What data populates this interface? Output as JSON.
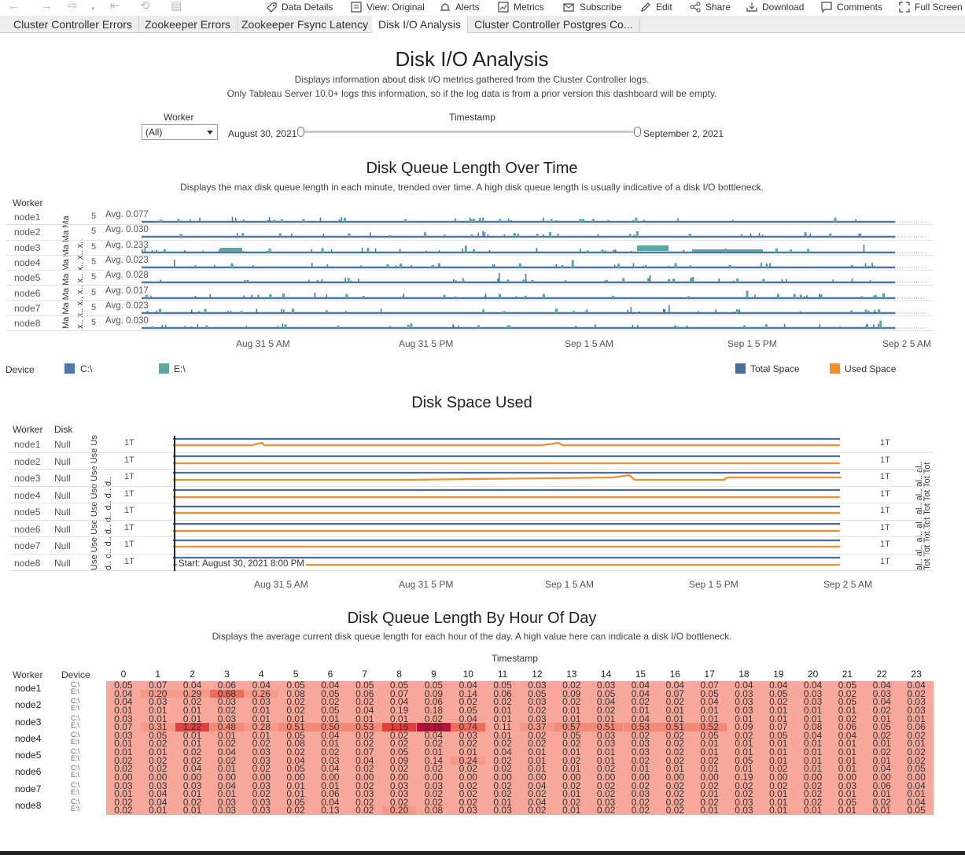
{
  "toolbar": {
    "items": [
      {
        "label": "Data Details",
        "icon": "bubble-icon"
      },
      {
        "label": "View: Original",
        "icon": "view-icon"
      },
      {
        "label": "Alerts",
        "icon": "bell-icon"
      },
      {
        "label": "Metrics",
        "icon": "metrics-icon"
      },
      {
        "label": "Subscribe",
        "icon": "mail-icon"
      },
      {
        "label": "Edit",
        "icon": "pencil-icon"
      },
      {
        "label": "Share",
        "icon": "share-icon"
      },
      {
        "label": "Download",
        "icon": "download-icon"
      },
      {
        "label": "Comments",
        "icon": "comment-icon"
      },
      {
        "label": "Full Screen",
        "icon": "fullscreen-icon"
      }
    ]
  },
  "tabs": [
    {
      "label": "Cluster Controller Errors",
      "active": false
    },
    {
      "label": "Zookeeper Errors",
      "active": false
    },
    {
      "label": "Zookeeper Fsync Latency",
      "active": false
    },
    {
      "label": "Disk I/O Analysis",
      "active": true
    },
    {
      "label": "Cluster Controller Postgres Co...",
      "active": false
    }
  ],
  "dashboard": {
    "title": "Disk I/O Analysis",
    "desc1": "Displays information about disk I/O metrics gathered from the Cluster Controller logs.",
    "desc2": "Only Tableau Server 10.0+ logs this information, so if the log data is from a prior version this dashboard will be empty."
  },
  "filters": {
    "worker_label": "Worker",
    "worker_value": "(All)",
    "timestamp_label": "Timestamp",
    "start": "August 30, 2021",
    "end": "September 2, 2021"
  },
  "queue_chart": {
    "title": "Disk Queue Length Over Time",
    "subtitle": "Displays the max disk queue length in each minute, trended over time.  A high disk queue length is usually indicative of a disk I/O bottleneck.",
    "header": "Worker",
    "rows": [
      {
        "node": "node1",
        "avg": "Avg. 0.077"
      },
      {
        "node": "node2",
        "avg": "Avg. 0.030"
      },
      {
        "node": "node3",
        "avg": "Avg. 0.233"
      },
      {
        "node": "node4",
        "avg": "Avg. 0.023"
      },
      {
        "node": "node5",
        "avg": "Avg. 0.028"
      },
      {
        "node": "node6",
        "avg": "Avg. 0.017"
      },
      {
        "node": "node7",
        "avg": "Avg. 0.023"
      },
      {
        "node": "node8",
        "avg": "Avg. 0.030"
      }
    ],
    "yticks": [
      "5",
      "5",
      "5",
      "5",
      "5",
      "5",
      "5",
      "5"
    ],
    "vertical_axis_a": "Ma Ma Ma Ma Ma Ma Ma Ma",
    "vertical_axis_b": "x.. x.. x.. x.. x.. x.. x.. x..",
    "xticks": [
      "Aug 31 5 AM",
      "Aug 31 5 PM",
      "Sep 1 5 AM",
      "Sep 1 5 PM",
      "Sep 2 5 AM"
    ]
  },
  "legends": {
    "device_label": "Device",
    "device_c": "C:\\",
    "device_e": "E:\\",
    "total": "Total Space",
    "used": "Used Space"
  },
  "space_chart": {
    "title": "Disk Space Used",
    "header_worker": "Worker",
    "header_disk": "Disk",
    "rows": [
      {
        "node": "node1",
        "disk": "Null"
      },
      {
        "node": "node2",
        "disk": "Null"
      },
      {
        "node": "node3",
        "disk": "Null"
      },
      {
        "node": "node4",
        "disk": "Null"
      },
      {
        "node": "node5",
        "disk": "Null"
      },
      {
        "node": "node6",
        "disk": "Null"
      },
      {
        "node": "node7",
        "disk": "Null"
      },
      {
        "node": "node8",
        "disk": "Null"
      }
    ],
    "left_tick": "1T",
    "right_tick": "1T",
    "left_vertical_a": "Use Use Use Use Use Use Use Use",
    "left_vertical_b": "d.. d.. d.. d.. d.. d.. d.. d..",
    "right_vertical_a": "Tot Tot Tot Tot Tot Tot Tot Tot",
    "right_vertical_b": "al.. al.. al.. al.. al.. al.. al.. al..",
    "annotation": "Start: August 30, 2021 8:00 PM",
    "xticks": [
      "Aug 31 5 AM",
      "Aug 31 5 PM",
      "Sep 1 5 AM",
      "Sep 1 5 PM",
      "Sep 2 5 AM"
    ]
  },
  "heat_chart": {
    "title": "Disk Queue Length By Hour Of Day",
    "subtitle": "Displays the average current disk queue length for each hour of the day.  A high value here can indicate a disk I/O bottleneck.",
    "col_header": "Timestamp",
    "header_worker": "Worker",
    "header_device": "Device",
    "hours": [
      "0",
      "1",
      "2",
      "3",
      "4",
      "5",
      "6",
      "7",
      "8",
      "9",
      "10",
      "11",
      "12",
      "13",
      "14",
      "15",
      "16",
      "17",
      "18",
      "19",
      "20",
      "21",
      "22",
      "23"
    ],
    "nodes": [
      "node1",
      "node2",
      "node3",
      "node4",
      "node5",
      "node6",
      "node7",
      "node8"
    ],
    "devices": [
      "C:\\",
      "E:\\"
    ],
    "rows": [
      [
        "0.05",
        "0.07",
        "0.04",
        "0.06",
        "0.04",
        "0.05",
        "0.04",
        "0.05",
        "0.05",
        "0.05",
        "0.04",
        "0.05",
        "0.03",
        "0.02",
        "0.03",
        "0.04",
        "0.04",
        "0.07",
        "0.04",
        "0.04",
        "0.04",
        "0.05",
        "0.04",
        "0.04"
      ],
      [
        "0.04",
        "0.20",
        "0.29",
        "0.68",
        "0.26",
        "0.08",
        "0.05",
        "0.06",
        "0.07",
        "0.09",
        "0.14",
        "0.06",
        "0.05",
        "0.09",
        "0.05",
        "0.04",
        "0.07",
        "0.05",
        "0.03",
        "0.05",
        "0.03",
        "0.02",
        "0.03",
        "0.02"
      ],
      [
        "0.04",
        "0.03",
        "0.02",
        "0.03",
        "0.03",
        "0.02",
        "0.02",
        "0.02",
        "0.04",
        "0.06",
        "0.02",
        "0.02",
        "0.03",
        "0.02",
        "0.04",
        "0.02",
        "0.02",
        "0.04",
        "0.03",
        "0.02",
        "0.03",
        "0.05",
        "0.04",
        "0.03"
      ],
      [
        "0.01",
        "0.01",
        "0.01",
        "0.02",
        "0.01",
        "0.02",
        "0.05",
        "0.04",
        "0.19",
        "0.18",
        "0.05",
        "0.01",
        "0.02",
        "0.01",
        "0.02",
        "0.01",
        "0.01",
        "0.01",
        "0.03",
        "0.01",
        "0.01",
        "0.01",
        "0.02",
        "0.03"
      ],
      [
        "0.03",
        "0.01",
        "0.01",
        "0.03",
        "0.01",
        "0.01",
        "0.01",
        "0.01",
        "0.01",
        "0.02",
        "0.04",
        "0.01",
        "0.03",
        "0.01",
        "0.01",
        "0.04",
        "0.01",
        "0.01",
        "0.01",
        "0.01",
        "0.01",
        "0.02",
        "0.01",
        "0.01"
      ],
      [
        "0.07",
        "0.31",
        "1.22",
        "0.48",
        "0.28",
        "0.51",
        "0.50",
        "0.53",
        "1.16",
        "2.16",
        "0.74",
        "0.11",
        "0.37",
        "0.57",
        "0.51",
        "0.53",
        "0.51",
        "0.52",
        "0.09",
        "0.07",
        "0.08",
        "0.06",
        "0.05",
        "0.06"
      ],
      [
        "0.03",
        "0.05",
        "0.01",
        "0.01",
        "0.01",
        "0.05",
        "0.04",
        "0.02",
        "0.02",
        "0.04",
        "0.03",
        "0.01",
        "0.02",
        "0.05",
        "0.03",
        "0.02",
        "0.02",
        "0.05",
        "0.02",
        "0.05",
        "0.04",
        "0.04",
        "0.02",
        "0.02"
      ],
      [
        "0.01",
        "0.02",
        "0.01",
        "0.02",
        "0.02",
        "0.08",
        "0.01",
        "0.02",
        "0.02",
        "0.02",
        "0.02",
        "0.02",
        "0.02",
        "0.02",
        "0.03",
        "0.03",
        "0.02",
        "0.01",
        "0.01",
        "0.01",
        "0.01",
        "0.01",
        "0.01",
        "0.01"
      ],
      [
        "0.01",
        "0.01",
        "0.02",
        "0.04",
        "0.03",
        "0.02",
        "0.02",
        "0.07",
        "0.05",
        "0.01",
        "0.01",
        "0.04",
        "0.01",
        "0.01",
        "0.01",
        "0.03",
        "0.02",
        "0.01",
        "0.01",
        "0.01",
        "0.01",
        "0.01",
        "0.02",
        "0.02"
      ],
      [
        "0.02",
        "0.02",
        "0.02",
        "0.02",
        "0.03",
        "0.04",
        "0.03",
        "0.04",
        "0.09",
        "0.14",
        "0.24",
        "0.02",
        "0.01",
        "0.02",
        "0.01",
        "0.02",
        "0.02",
        "0.02",
        "0.05",
        "0.01",
        "0.01",
        "0.01",
        "0.01",
        "0.02"
      ],
      [
        "0.02",
        "0.02",
        "0.04",
        "0.01",
        "0.02",
        "0.05",
        "0.04",
        "0.02",
        "0.02",
        "0.02",
        "0.02",
        "0.02",
        "0.01",
        "0.01",
        "0.02",
        "0.01",
        "0.01",
        "0.01",
        "0.01",
        "0.02",
        "0.01",
        "0.01",
        "0.04",
        "0.05"
      ],
      [
        "0.00",
        "0.00",
        "0.00",
        "0.00",
        "0.00",
        "0.00",
        "0.00",
        "0.00",
        "0.00",
        "0.00",
        "0.00",
        "0.00",
        "0.00",
        "0.00",
        "0.00",
        "0.00",
        "0.00",
        "0.00",
        "0.19",
        "0.00",
        "0.00",
        "0.00",
        "0.00",
        "0.00"
      ],
      [
        "0.03",
        "0.03",
        "0.03",
        "0.04",
        "0.03",
        "0.01",
        "0.01",
        "0.02",
        "0.03",
        "0.03",
        "0.02",
        "0.02",
        "0.04",
        "0.02",
        "0.02",
        "0.02",
        "0.02",
        "0.02",
        "0.02",
        "0.02",
        "0.02",
        "0.03",
        "0.06",
        "0.04"
      ],
      [
        "0.01",
        "0.04",
        "0.01",
        "0.01",
        "0.02",
        "0.01",
        "0.06",
        "0.03",
        "0.03",
        "0.02",
        "0.02",
        "0.02",
        "0.02",
        "0.01",
        "0.02",
        "0.03",
        "0.02",
        "0.01",
        "0.02",
        "0.01",
        "0.02",
        "0.01",
        "0.01",
        "0.01"
      ],
      [
        "0.02",
        "0.04",
        "0.02",
        "0.03",
        "0.03",
        "0.05",
        "0.04",
        "0.02",
        "0.02",
        "0.02",
        "0.02",
        "0.01",
        "0.04",
        "0.02",
        "0.03",
        "0.02",
        "0.02",
        "0.02",
        "0.03",
        "0.01",
        "0.02",
        "0.05",
        "0.02",
        "0.04"
      ],
      [
        "0.02",
        "0.01",
        "0.01",
        "0.03",
        "0.03",
        "0.02",
        "0.13",
        "0.02",
        "0.20",
        "0.08",
        "0.03",
        "0.03",
        "0.02",
        "0.01",
        "0.02",
        "0.02",
        "0.02",
        "0.01",
        "0.03",
        "0.01",
        "0.01",
        "0.01",
        "0.01",
        "0.05"
      ]
    ]
  },
  "colors": {
    "c_drive": "#4e79a7",
    "e_drive": "#5aa89e",
    "total": "#4a6e9c",
    "used": "#f28e2b",
    "heat_low": "#f7a89b",
    "heat_high": "#b5133a"
  }
}
